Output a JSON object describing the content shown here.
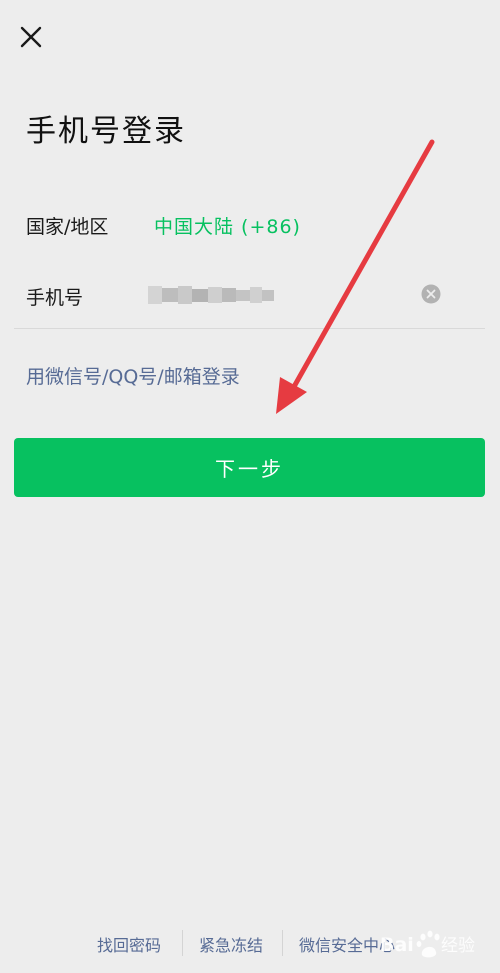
{
  "header": {
    "close_icon": "close-icon",
    "title": "手机号登录"
  },
  "form": {
    "region_label": "国家/地区",
    "region_value": "中国大陆 (+86)",
    "phone_label": "手机号",
    "phone_value": "",
    "clear_icon": "clear-circle-icon"
  },
  "alt_login": "用微信号/QQ号/邮箱登录",
  "next_button": "下一步",
  "footer": {
    "links": [
      "找回密码",
      "紧急冻结",
      "微信安全中心"
    ]
  },
  "colors": {
    "background": "#ededed",
    "primary_green": "#07c160",
    "link_blue": "#576b95",
    "annotation_arrow": "#e63b41"
  },
  "annotation": {
    "arrow_icon": "red-arrow-icon"
  },
  "watermark": {
    "text": "Bai百经验"
  }
}
